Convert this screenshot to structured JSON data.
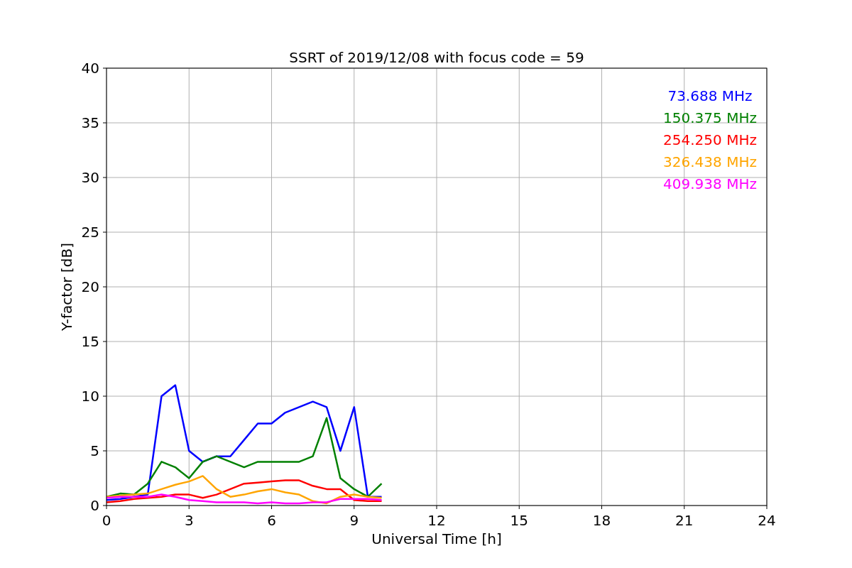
{
  "chart": {
    "chart_data": {
      "type": "line",
      "title": "SSRT of 2019/12/08 with focus code = 59",
      "xlabel": "Universal Time [h]",
      "ylabel": "Y-factor [dB]",
      "x": [
        0,
        0.5,
        1,
        1.5,
        2,
        2.5,
        3,
        3.5,
        4,
        4.5,
        5,
        5.5,
        6,
        6.5,
        7,
        7.5,
        8,
        8.5,
        9,
        9.5,
        10
      ],
      "grid": true,
      "xlim": [
        0,
        24
      ],
      "ylim": [
        0,
        40
      ],
      "xticks": [
        0,
        3,
        6,
        9,
        12,
        15,
        18,
        21,
        24
      ],
      "yticks": [
        0,
        5,
        10,
        15,
        20,
        25,
        30,
        35,
        40
      ],
      "series": [
        {
          "name": "73.688 MHz",
          "color": "#0000ff",
          "values": [
            0.5,
            0.6,
            0.8,
            1,
            10,
            11,
            5,
            4,
            4.5,
            4.5,
            6,
            7.5,
            7.5,
            8.5,
            9,
            9.5,
            9,
            5,
            9,
            0.8,
            0.8
          ]
        },
        {
          "name": "150.375 MHz",
          "color": "#008000",
          "values": [
            0.8,
            1.1,
            1,
            2,
            4,
            3.5,
            2.5,
            4,
            4.5,
            4,
            3.5,
            4,
            4,
            4,
            4,
            4.5,
            8,
            2.5,
            1.5,
            0.8,
            2
          ]
        },
        {
          "name": "254.250 MHz",
          "color": "#ff0000",
          "values": [
            0.3,
            0.4,
            0.6,
            0.7,
            0.8,
            1,
            1,
            0.7,
            1,
            1.5,
            2,
            2.1,
            2.2,
            2.3,
            2.3,
            1.8,
            1.5,
            1.5,
            0.5,
            0.4,
            0.4
          ]
        },
        {
          "name": "326.438 MHz",
          "color": "#ffa500",
          "values": [
            0.8,
            0.9,
            1,
            1.1,
            1.5,
            1.9,
            2.2,
            2.7,
            1.5,
            0.8,
            1,
            1.3,
            1.5,
            1.2,
            1,
            0.4,
            0.2,
            0.8,
            1,
            0.8,
            0.7
          ]
        },
        {
          "name": "409.938 MHz",
          "color": "#ff00ff",
          "values": [
            0.7,
            0.8,
            0.8,
            0.8,
            1,
            0.8,
            0.5,
            0.4,
            0.3,
            0.3,
            0.3,
            0.2,
            0.3,
            0.2,
            0.2,
            0.3,
            0.3,
            0.6,
            0.6,
            0.6,
            0.5
          ]
        }
      ]
    }
  }
}
